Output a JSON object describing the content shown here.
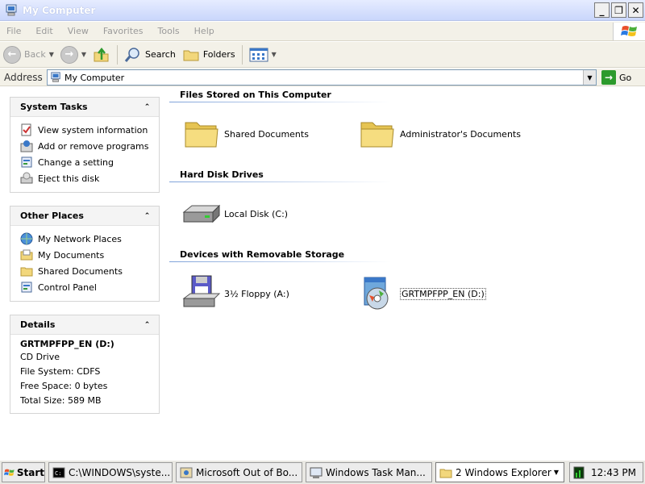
{
  "window": {
    "title": "My Computer",
    "controls": {
      "minimize": "_",
      "restore": "❐",
      "close": "✕"
    }
  },
  "menu": [
    "File",
    "Edit",
    "View",
    "Favorites",
    "Tools",
    "Help"
  ],
  "toolbar": {
    "back_label": "Back",
    "search_label": "Search",
    "folders_label": "Folders"
  },
  "address": {
    "label": "Address",
    "value": "My Computer",
    "go_label": "Go"
  },
  "system_tasks": {
    "title": "System Tasks",
    "items": [
      "View system information",
      "Add or remove programs",
      "Change a setting",
      "Eject this disk"
    ]
  },
  "other_places": {
    "title": "Other Places",
    "items": [
      "My Network Places",
      "My Documents",
      "Shared Documents",
      "Control Panel"
    ]
  },
  "details": {
    "title": "Details",
    "name": "GRTMPFPP_EN (D:)",
    "type": "CD Drive",
    "file_system": "File System: CDFS",
    "free_space": "Free Space: 0 bytes",
    "total_size": "Total Size: 589 MB"
  },
  "groups": [
    {
      "title": "Files Stored on This Computer",
      "items": [
        "Shared Documents",
        "Administrator's Documents"
      ]
    },
    {
      "title": "Hard Disk Drives",
      "items": [
        "Local Disk (C:)"
      ]
    },
    {
      "title": "Devices with Removable Storage",
      "items": [
        "3½ Floppy (A:)",
        "GRTMPFPP_EN (D:)"
      ]
    }
  ],
  "taskbar": {
    "start_label": "Start",
    "tasks": [
      "C:\\WINDOWS\\syste...",
      "Microsoft Out of Bo...",
      "Windows Task Man...",
      "2 Windows Explorer"
    ],
    "clock": "12:43 PM"
  }
}
